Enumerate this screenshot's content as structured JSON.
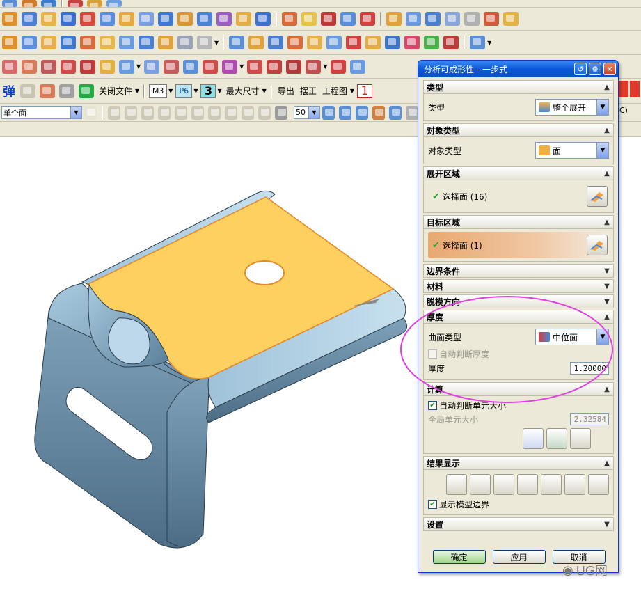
{
  "toolbar3": {
    "flip_label": "弹",
    "close_file_label": "关闭文件",
    "m3_label": "M3",
    "p6_label": "P6",
    "three_label": "3",
    "max_size_label": "最大尺寸",
    "export_label": "导出",
    "straighten_label": "摆正",
    "drawing_label": "工程图",
    "one_label": "1"
  },
  "toolbar4": {
    "selection_filter_value": "单个面",
    "count_value": "50",
    "right_hint": "C)"
  },
  "dialog": {
    "title": "分析可成形性 - 一步式",
    "sections": {
      "type": {
        "header": "类型",
        "label": "类型",
        "value": "整个展开"
      },
      "object_type": {
        "header": "对象类型",
        "label": "对象类型",
        "value": "面"
      },
      "unfold_region": {
        "header": "展开区域",
        "select_label": "选择面 (16)"
      },
      "target_region": {
        "header": "目标区域",
        "select_label": "选择面 (1)"
      },
      "boundary": {
        "header": "边界条件"
      },
      "material": {
        "header": "材料"
      },
      "draft": {
        "header": "脱模方向"
      },
      "thickness": {
        "header": "厚度",
        "surface_type_label": "曲面类型",
        "surface_type_value": "中位面",
        "auto_thickness_label": "自动判断厚度",
        "thickness_label": "厚度",
        "thickness_value": "1.20000"
      },
      "compute": {
        "header": "计算",
        "auto_size_label": "自动判断单元大小",
        "global_size_label": "全局单元大小",
        "global_size_value": "2.32584"
      },
      "results": {
        "header": "结果显示",
        "show_boundary_label": "显示模型边界"
      },
      "settings": {
        "header": "设置"
      }
    },
    "buttons": {
      "ok": "确定",
      "apply": "应用",
      "cancel": "取消"
    }
  },
  "watermark": {
    "text": "UG网"
  }
}
